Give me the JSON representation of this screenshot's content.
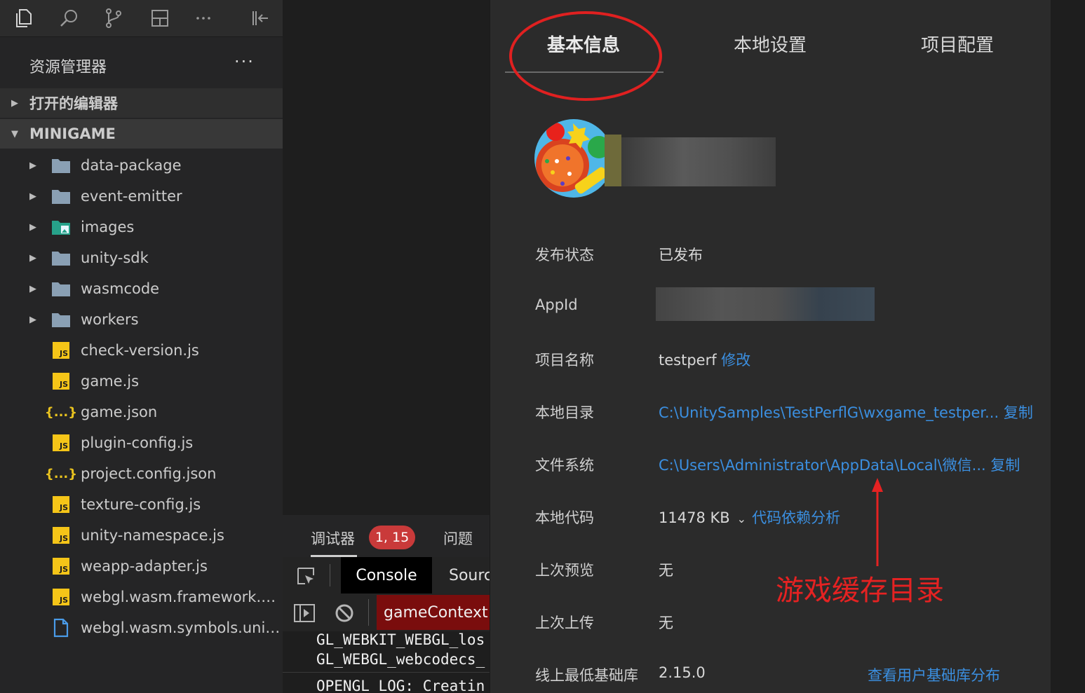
{
  "explorer": {
    "title": "资源管理器",
    "more": "···",
    "sections": [
      {
        "label": "打开的编辑器",
        "expanded": false
      },
      {
        "label": "MINIGAME",
        "expanded": true
      }
    ],
    "items": [
      {
        "name": "data-package",
        "type": "folder"
      },
      {
        "name": "event-emitter",
        "type": "folder"
      },
      {
        "name": "images",
        "type": "image-folder"
      },
      {
        "name": "unity-sdk",
        "type": "folder"
      },
      {
        "name": "wasmcode",
        "type": "folder"
      },
      {
        "name": "workers",
        "type": "folder"
      },
      {
        "name": "check-version.js",
        "type": "js"
      },
      {
        "name": "game.js",
        "type": "js"
      },
      {
        "name": "game.json",
        "type": "json"
      },
      {
        "name": "plugin-config.js",
        "type": "js"
      },
      {
        "name": "project.config.json",
        "type": "json"
      },
      {
        "name": "texture-config.js",
        "type": "js"
      },
      {
        "name": "unity-namespace.js",
        "type": "js"
      },
      {
        "name": "weapp-adapter.js",
        "type": "js"
      },
      {
        "name": "webgl.wasm.framework.unit...",
        "type": "js"
      },
      {
        "name": "webgl.wasm.symbols.unity...",
        "type": "file"
      }
    ],
    "icon_labels": {
      "js": "JS",
      "json": "{...}"
    }
  },
  "debugger": {
    "tab_debugger": "调试器",
    "badge": "1, 15",
    "tab_issues": "问题",
    "console": "Console",
    "sources": "Sourc",
    "context": "gameContext",
    "code_lines": [
      "GL_WEBKIT_WEBGL_los",
      "GL_WEBGL_webcodecs_",
      "OPENGL_LOG: Creatin"
    ]
  },
  "panel": {
    "tabs": [
      "基本信息",
      "本地设置",
      "项目配置"
    ],
    "rows": {
      "publish_status": {
        "label": "发布状态",
        "value": "已发布"
      },
      "appid": {
        "label": "AppId"
      },
      "project_name": {
        "label": "项目名称",
        "value": "testperf",
        "link": "修改"
      },
      "local_dir": {
        "label": "本地目录",
        "value": "C:\\UnitySamples\\TestPerflG\\wxgame_testper...",
        "link": "复制"
      },
      "file_system": {
        "label": "文件系统",
        "value": "C:\\Users\\Administrator\\AppData\\Local\\微信...",
        "link": "复制"
      },
      "local_code": {
        "label": "本地代码",
        "value": "11478 KB",
        "link": "代码依赖分析"
      },
      "last_preview": {
        "label": "上次预览",
        "value": "无"
      },
      "last_upload": {
        "label": "上次上传",
        "value": "无"
      },
      "min_lib": {
        "label": "线上最低基础库",
        "value": "2.15.0",
        "link": "查看用户基础库分布"
      }
    },
    "annotation": "游戏缓存目录"
  },
  "colors": {
    "accent_link": "#3b8fe0",
    "annotation_red": "#e52222",
    "badge_red": "#c93a3a"
  }
}
